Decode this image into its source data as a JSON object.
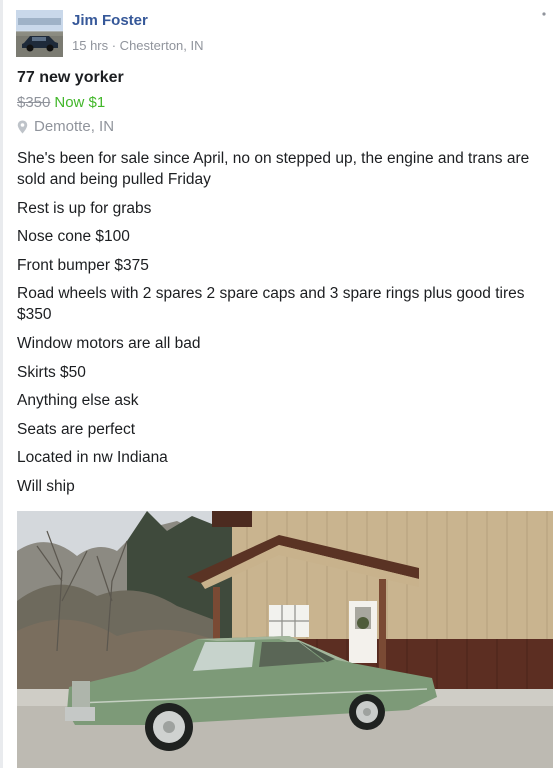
{
  "post": {
    "author": "Jim Foster",
    "meta": "15 hrs · Chesterton, IN",
    "icons": {
      "more": "more-dots-icon",
      "location": "location-pin-icon"
    }
  },
  "listing": {
    "title": "77 new yorker",
    "old_price": "$350",
    "new_price": "Now $1",
    "location": "Demotte, IN",
    "colors": {
      "new_price": "#42b72a",
      "author": "#365899"
    },
    "description": [
      "She's been for sale since April, no on stepped up, the engine and trans are sold and being pulled Friday",
      "Rest is up for grabs",
      "Nose cone $100",
      "Front bumper $375",
      "Road wheels with 2 spares 2 spare caps and 3 spare rings plus good tires $350",
      "Window motors are all bad",
      "Skirts $50",
      "Anything else ask",
      "Seats are perfect",
      "Located in nw Indiana",
      "Will ship"
    ]
  }
}
